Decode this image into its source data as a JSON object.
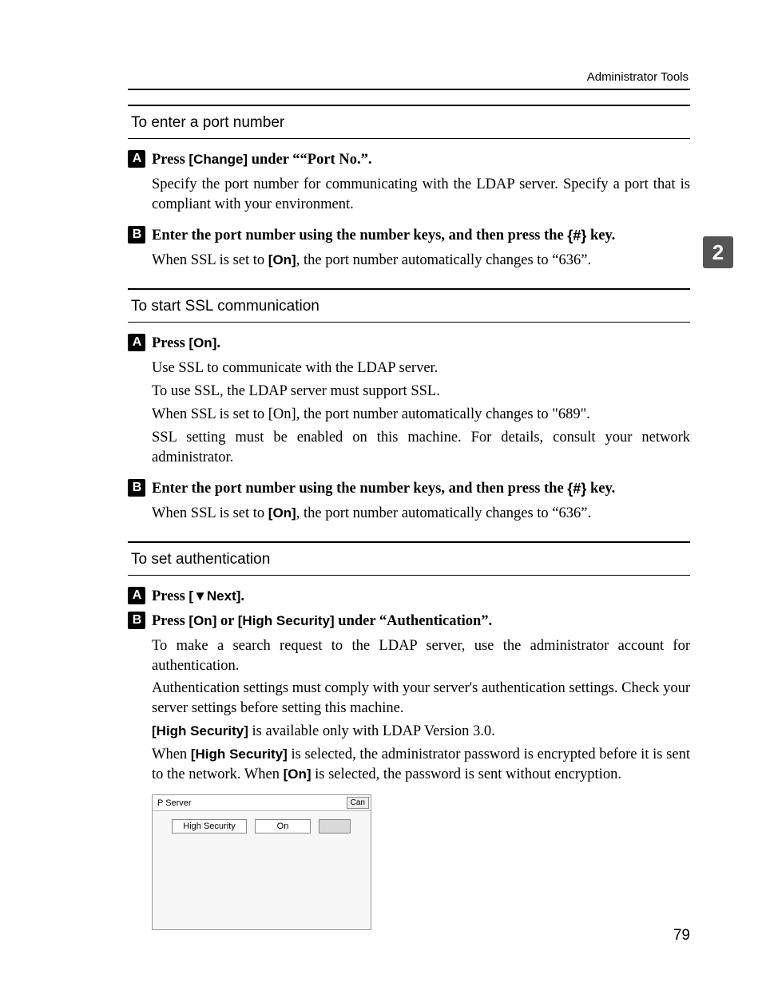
{
  "header": {
    "label": "Administrator Tools"
  },
  "chapter_tab": "2",
  "page_number": "79",
  "sections": [
    {
      "title": "To enter a port number",
      "steps": [
        {
          "num": "A",
          "instr_pre": "Press ",
          "instr_b1": "[Change]",
          "instr_post": " under ““Port No.”.",
          "paras": [
            {
              "t": "Specify the port number for communicating with the LDAP server. Specify a port that is compliant with your environment."
            }
          ]
        },
        {
          "num": "B",
          "instr_pre": "Enter the port number using the number keys, and then press the ",
          "instr_hash": "{#}",
          "instr_post": " key.",
          "paras": [
            {
              "pre": "When SSL is set to ",
              "b1": "[On]",
              "post": ", the port number automatically changes to “636”."
            }
          ]
        }
      ]
    },
    {
      "title": "To start SSL communication",
      "steps": [
        {
          "num": "A",
          "instr_pre": "Press ",
          "instr_b1": "[On]",
          "instr_post": ".",
          "paras": [
            {
              "t": "Use SSL to communicate with the LDAP server."
            },
            {
              "t": "To use SSL, the LDAP server must support SSL."
            },
            {
              "t": "When SSL is set to [On], the port number automatically changes to \"689\"."
            },
            {
              "t": "SSL setting must be enabled on this machine. For details, consult your network administrator."
            }
          ]
        },
        {
          "num": "B",
          "instr_pre": "Enter the port number using the number keys, and then press the ",
          "instr_hash": "{#}",
          "instr_post": " key.",
          "paras": [
            {
              "pre": "When SSL is set to ",
              "b1": "[On]",
              "post": ", the port number automatically changes to “636”."
            }
          ]
        }
      ]
    },
    {
      "title": "To set authentication",
      "steps": [
        {
          "num": "A",
          "instr_pre": "Press ",
          "instr_b1": "[▼Next]",
          "instr_post": "."
        },
        {
          "num": "B",
          "instr_pre": "Press ",
          "instr_b1": "[On]",
          "instr_mid": " or ",
          "instr_b2": "[High Security]",
          "instr_post": " under “Authentication”.",
          "paras": [
            {
              "t": "To make a search request to the LDAP server, use the administrator account for authentication."
            },
            {
              "t": "Authentication settings must comply with your server's authentication settings. Check your server settings before setting this machine."
            },
            {
              "b1": "[High Security]",
              "post": " is available only with LDAP Version 3.0."
            },
            {
              "pre": "When ",
              "b1": "[High Security]",
              "mid": " is selected, the administrator password is encrypted before it is sent to the network. When ",
              "b2": "[On]",
              "post": " is selected, the password is sent without encryption."
            }
          ]
        }
      ]
    }
  ],
  "screenshot": {
    "title_left": "P Server",
    "title_right_btn": "Can",
    "buttons": {
      "high_sec": "High Security",
      "on": "On"
    }
  }
}
